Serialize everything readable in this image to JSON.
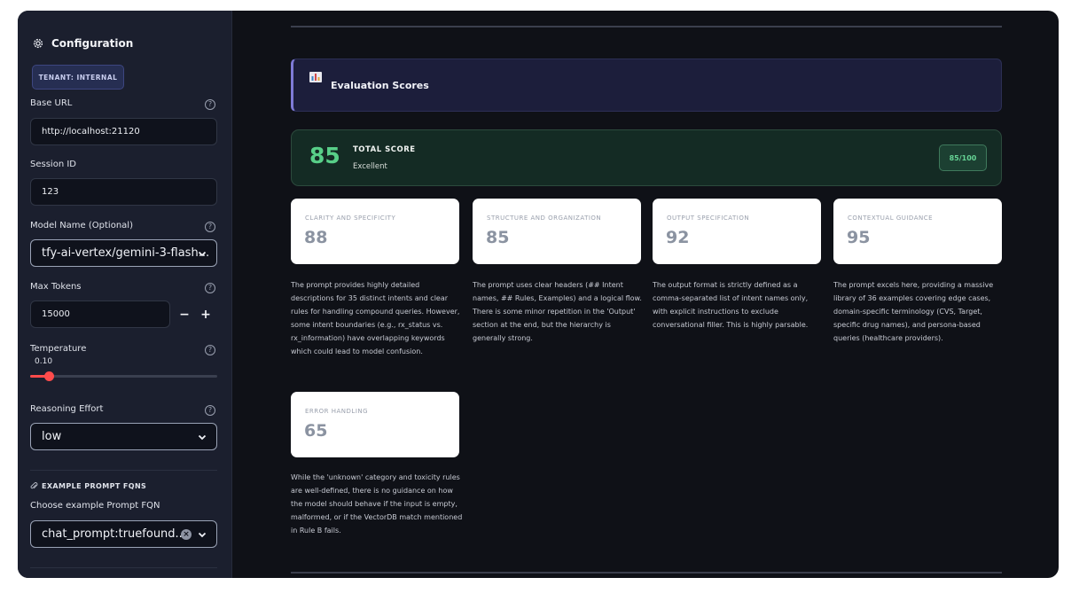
{
  "sidebar": {
    "title": "Configuration",
    "tenant_badge": "TENANT: INTERNAL",
    "base_url": {
      "label": "Base URL",
      "value": "http://localhost:21120"
    },
    "session_id": {
      "label": "Session ID",
      "value": "123"
    },
    "model_name": {
      "label": "Model Name (Optional)",
      "value": "tfy-ai-vertex/gemini-3-flash..."
    },
    "max_tokens": {
      "label": "Max Tokens",
      "value": "15000",
      "minus": "−",
      "plus": "+"
    },
    "temperature": {
      "label": "Temperature",
      "value": "0.10",
      "level": 0.1
    },
    "reasoning_effort": {
      "label": "Reasoning Effort",
      "value": "low"
    },
    "examples": {
      "heading": "EXAMPLE PROMPT FQNS",
      "label": "Choose example Prompt FQN",
      "value": "chat_prompt:truefound..."
    },
    "help_glyph": "?"
  },
  "main": {
    "eval_title": "Evaluation Scores",
    "total": {
      "score": "85",
      "label": "TOTAL SCORE",
      "rating": "Excellent",
      "badge": "85/100"
    },
    "cards": [
      {
        "label": "CLARITY AND SPECIFICITY",
        "score": "88",
        "text": "The prompt provides highly detailed descriptions for 35 distinct intents and clear rules for handling compound queries. However, some intent boundaries (e.g., rx_status vs. rx_information) have overlapping keywords which could lead to model confusion."
      },
      {
        "label": "STRUCTURE AND ORGANIZATION",
        "score": "85",
        "text": "The prompt uses clear headers (## Intent names, ## Rules, Examples) and a logical flow. There is some minor repetition in the 'Output' section at the end, but the hierarchy is generally strong."
      },
      {
        "label": "OUTPUT SPECIFICATION",
        "score": "92",
        "text": "The output format is strictly defined as a comma-separated list of intent names only, with explicit instructions to exclude conversational filler. This is highly parsable."
      },
      {
        "label": "CONTEXTUAL GUIDANCE",
        "score": "95",
        "text": "The prompt excels here, providing a massive library of 36 examples covering edge cases, domain-specific terminology (CVS, Target, specific drug names), and persona-based queries (healthcare providers)."
      },
      {
        "label": "ERROR HANDLING",
        "score": "65",
        "text": "While the 'unknown' category and toxicity rules are well-defined, there is no guidance on how the model should behave if the input is empty, malformed, or if the VectorDB match mentioned in Rule B fails."
      }
    ]
  },
  "colors": {
    "accent_red": "#ff4b4b",
    "score_green": "#58cf88",
    "banner_purple": "#7e7ad6"
  },
  "icons": [
    "gear-icon",
    "help-icon",
    "chevron-down-icon",
    "clear-icon",
    "paperclip-icon",
    "bar-chart-icon"
  ]
}
